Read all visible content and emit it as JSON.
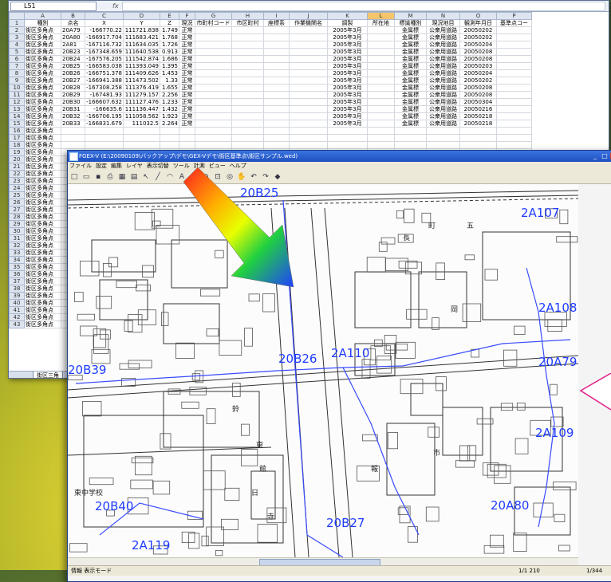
{
  "excel": {
    "namebox": "L51",
    "fx": "fx",
    "columns": [
      "A",
      "B",
      "C",
      "D",
      "E",
      "F",
      "G",
      "H",
      "I",
      "J",
      "K",
      "L",
      "M",
      "N",
      "O",
      "P"
    ],
    "header": [
      "種別",
      "点名",
      "X",
      "Y",
      "Z",
      "現況",
      "市町村コード",
      "市区町村",
      "座標系",
      "作業機関名",
      "調製",
      "所在地",
      "標識種別",
      "現況地目",
      "観測年月日",
      "基準点コー"
    ],
    "rows": [
      [
        "街区多角点",
        "20A79",
        "-166770.22",
        "111721.838",
        "1.749",
        "正常",
        "",
        "",
        "",
        "",
        "2005年3月",
        "",
        "金属標",
        "公衆用道路",
        "20050202"
      ],
      [
        "街区多角点",
        "20A80",
        "-166917.704",
        "111683.421",
        "1.768",
        "正常",
        "",
        "",
        "",
        "",
        "2005年3月",
        "",
        "金属標",
        "公衆用道路",
        "20050202"
      ],
      [
        "街区多角点",
        "2A81",
        "-167116.732",
        "111634.035",
        "1.726",
        "正常",
        "",
        "",
        "",
        "",
        "2005年3月",
        "",
        "金属標",
        "公衆用道路",
        "20050204"
      ],
      [
        "街区多角点",
        "20B23",
        "-167348.659",
        "111640.538",
        "0.913",
        "正常",
        "",
        "",
        "",
        "",
        "2005年3月",
        "",
        "金属標",
        "公衆用道路",
        "20050208"
      ],
      [
        "街区多角点",
        "20B24",
        "-167576.205",
        "111542.874",
        "1.686",
        "正常",
        "",
        "",
        "",
        "",
        "2005年3月",
        "",
        "金属標",
        "公衆用道路",
        "20050208"
      ],
      [
        "街区多角点",
        "20B25",
        "-166583.038",
        "111393.049",
        "1.395",
        "正常",
        "",
        "",
        "",
        "",
        "2005年3月",
        "",
        "金属標",
        "公衆用道路",
        "20050203"
      ],
      [
        "街区多角点",
        "20B26",
        "-166751.378",
        "111409.626",
        "1.453",
        "正常",
        "",
        "",
        "",
        "",
        "2005年3月",
        "",
        "金属標",
        "公衆用道路",
        "20050204"
      ],
      [
        "街区多角点",
        "20B27",
        "-166941.388",
        "111473.502",
        "1.33",
        "正常",
        "",
        "",
        "",
        "",
        "2005年3月",
        "",
        "金属標",
        "公衆用道路",
        "20050202"
      ],
      [
        "街区多角点",
        "20B28",
        "-167308.258",
        "111376.419",
        "1.655",
        "正常",
        "",
        "",
        "",
        "",
        "2005年3月",
        "",
        "金属標",
        "公衆用道路",
        "20050208"
      ],
      [
        "街区多角点",
        "20B29",
        "-167481.93",
        "111279.157",
        "2.256",
        "正常",
        "",
        "",
        "",
        "",
        "2005年3月",
        "",
        "金属標",
        "公衆用道路",
        "20050208"
      ],
      [
        "街区多角点",
        "20B30",
        "-166607.632",
        "111127.476",
        "1.233",
        "正常",
        "",
        "",
        "",
        "",
        "2005年3月",
        "",
        "金属標",
        "公衆用道路",
        "20050304"
      ],
      [
        "街区多角点",
        "20B31",
        "-166635.6",
        "111136.447",
        "1.432",
        "正常",
        "",
        "",
        "",
        "",
        "2005年3月",
        "",
        "金属標",
        "公衆用道路",
        "20050216"
      ],
      [
        "街区多角点",
        "20B32",
        "-166706.195",
        "111058.562",
        "1.923",
        "正常",
        "",
        "",
        "",
        "",
        "2005年3月",
        "",
        "金属標",
        "公衆用道路",
        "20050218"
      ],
      [
        "街区多角点",
        "20B33",
        "-166831.679",
        "111032.5",
        "2.264",
        "正常",
        "",
        "",
        "",
        "",
        "2005年3月",
        "",
        "金属標",
        "公衆用道路",
        "20050218"
      ],
      [
        "街区多角点"
      ],
      [
        "街区多角点"
      ],
      [
        "街区多角点"
      ],
      [
        "街区多角点"
      ],
      [
        "街区多角点"
      ],
      [
        "街区多角点"
      ],
      [
        "街区多角点"
      ],
      [
        "街区多角点"
      ],
      [
        "街区多角点"
      ],
      [
        "街区多角点"
      ],
      [
        "街区多角点"
      ],
      [
        "街区多角点"
      ],
      [
        "街区多角点"
      ],
      [
        "街区多角点"
      ],
      [
        "街区多角点"
      ],
      [
        "街区多角点"
      ],
      [
        "街区多角点"
      ],
      [
        "街区多角点"
      ],
      [
        "街区多角点"
      ],
      [
        "街区多角点"
      ],
      [
        "街区多角点"
      ],
      [
        "街区多角点"
      ],
      [
        "街区多角点"
      ],
      [
        "街区多角点"
      ],
      [
        "街区多角点"
      ],
      [
        "街区多角点"
      ],
      [
        "街区多角点"
      ],
      [
        "街区多角点"
      ]
    ],
    "sheet_tab": "街区三角"
  },
  "gex": {
    "title": "FGEX-V (E:\\20090109\\バックアップ\\デモ\\GEX-Vデモ\\街区基準点\\街区サンプル.wed)",
    "menu": [
      "ファイル",
      "設定",
      "編集",
      "レイヤ",
      "表示切替",
      "ツール",
      "計測",
      "ビュー",
      "ヘルプ"
    ],
    "toolbar_icons": [
      "new-icon",
      "open-icon",
      "save-icon",
      "print-icon",
      "table-icon",
      "grid-icon",
      "pointer-icon",
      "line-icon",
      "arc-icon",
      "text-icon",
      "zoom-in-icon",
      "zoom-out-icon",
      "zoom-window-icon",
      "zoom-fit-icon",
      "pan-icon",
      "undo-icon",
      "redo-icon",
      "eraser-icon"
    ],
    "labels": [
      "20B25",
      "2A107",
      "2A108",
      "20B26",
      "2A110",
      "20A79",
      "20B39",
      "2A109",
      "20B40",
      "20A80",
      "20B27",
      "2A119"
    ],
    "map_text": [
      "町",
      "五",
      "東中学校",
      "鈴",
      "東",
      "館",
      "日",
      "市",
      "報",
      "長",
      "岡",
      "寺"
    ],
    "status_left": "情報 表示モード",
    "status_page": "1/1 210",
    "status_right": "1/344"
  }
}
